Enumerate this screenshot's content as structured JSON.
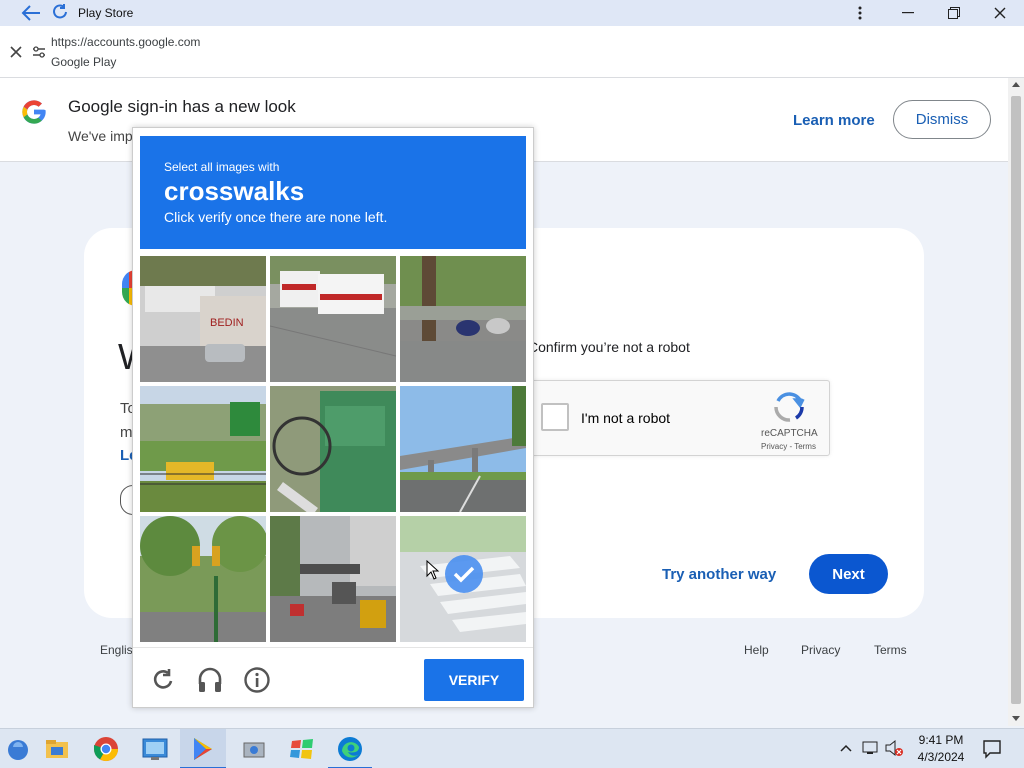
{
  "window": {
    "title": "Play Store"
  },
  "address_bar": {
    "url": "https://accounts.google.com",
    "site_name": "Google Play"
  },
  "banner": {
    "title": "Google sign-in has a new look",
    "subtitle": "We've imp",
    "learn_more": "Learn more",
    "dismiss": "Dismiss"
  },
  "signin_card": {
    "heading_peek": "W",
    "text_peek_1": "To",
    "text_peek_2": "m",
    "link_peek": "Le",
    "confirm_text": "Confirm you’re not a robot",
    "try_another": "Try another way",
    "next": "Next"
  },
  "recaptcha_box": {
    "checkbox_label": "I'm not a robot",
    "brand": "reCAPTCHA",
    "links": "Privacy - Terms",
    "checked": false
  },
  "captcha_challenge": {
    "instruction_top": "Select all images with",
    "target": "crosswalks",
    "instruction_bottom": "Click verify once there are none left.",
    "tiles": [
      {
        "scene": "buses parked by a lot with a white wall",
        "selected": false
      },
      {
        "scene": "bus driving on a road",
        "selected": false
      },
      {
        "scene": "motorcycles parked beside a tree",
        "selected": false
      },
      {
        "scene": "yellow bus behind a green fence",
        "selected": false
      },
      {
        "scene": "bicycle next to a green box",
        "selected": false
      },
      {
        "scene": "elevated highway over a road",
        "selected": false
      },
      {
        "scene": "street with trees and traffic lights",
        "selected": false
      },
      {
        "scene": "busy city street with vehicles",
        "selected": false
      },
      {
        "scene": "crosswalk stripes on road",
        "selected": true
      }
    ],
    "verify": "VERIFY",
    "icons": [
      "reload-icon",
      "audio-headphones-icon",
      "info-icon"
    ]
  },
  "footer": {
    "language": "Englis",
    "links": [
      "Help",
      "Privacy",
      "Terms"
    ]
  },
  "taskbar": {
    "apps": [
      "start-icon",
      "file-explorer-icon",
      "chrome-icon",
      "control-panel-icon",
      "play-store-icon",
      "disk-cleanup-icon",
      "windows-logo-icon",
      "edge-icon"
    ],
    "time": "9:41 PM",
    "date": "4/3/2024"
  },
  "colors": {
    "accent_blue": "#1a73e8",
    "button_blue": "#0b57d0",
    "link_blue": "#1a5fb4"
  }
}
